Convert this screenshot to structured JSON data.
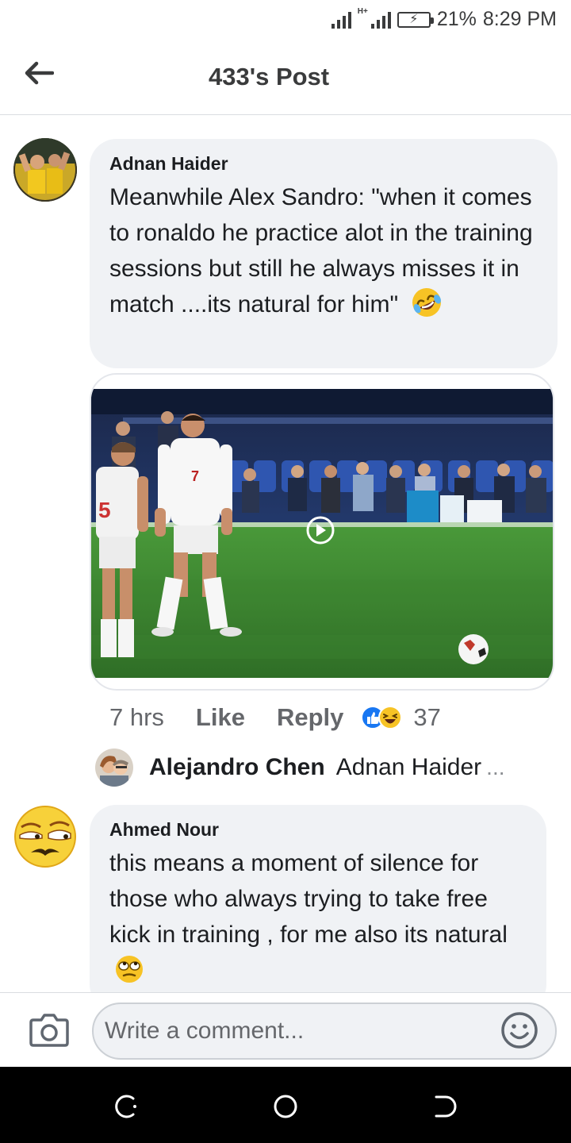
{
  "status_bar": {
    "network": "H+",
    "battery": "21%",
    "time": "8:29 PM"
  },
  "header": {
    "title": "433's Post"
  },
  "comments": [
    {
      "author": "Adnan Haider",
      "text": "Meanwhile Alex Sandro: \"when it comes to ronaldo he practice alot in the training sessions but still he always misses it in match ....its natural for him\"",
      "media": {
        "type": "video",
        "icon": "play-icon"
      },
      "time": "7 hrs",
      "like_label": "Like",
      "reply_label": "Reply",
      "reaction_count": "37",
      "reply_preview": {
        "name": "Alejandro Chen",
        "text": "Adnan Haider",
        "more": "..."
      }
    },
    {
      "author": "Ahmed Nour",
      "text": "this means a moment of silence for those who always trying to take free kick in training , for me also its natural"
    }
  ],
  "composer": {
    "placeholder": "Write a comment..."
  },
  "colors": {
    "accent": "#1877f2",
    "bubble": "#f0f2f5",
    "pitch": "#3f8a33"
  }
}
